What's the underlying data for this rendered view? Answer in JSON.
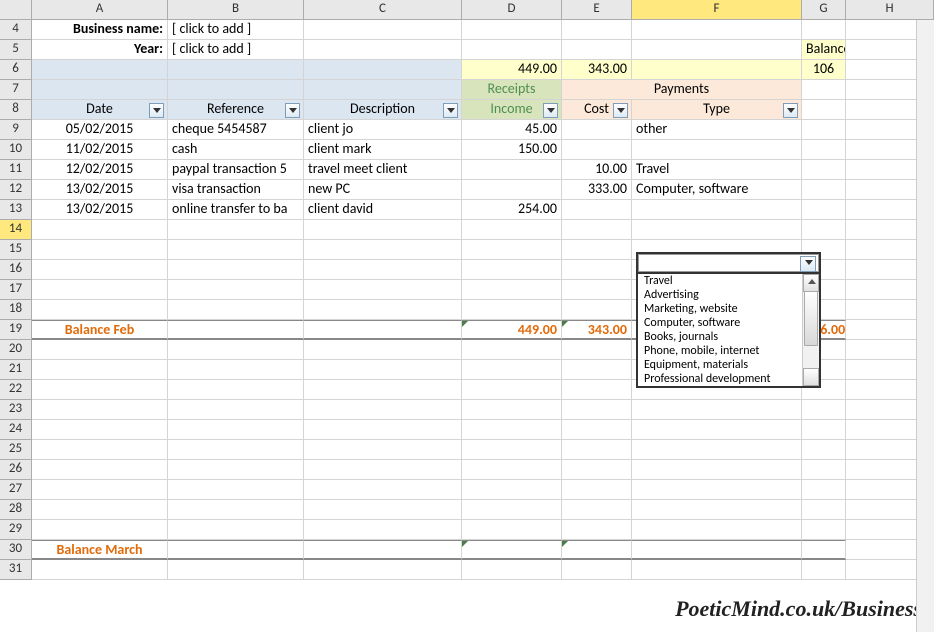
{
  "columns": [
    "A",
    "B",
    "C",
    "D",
    "E",
    "F",
    "G",
    "H"
  ],
  "rowNums": [
    4,
    5,
    6,
    7,
    8,
    9,
    10,
    11,
    12,
    13,
    14,
    15,
    16,
    17,
    18,
    19,
    20,
    21,
    22,
    23,
    24,
    25,
    26,
    27,
    28,
    29,
    30,
    31
  ],
  "labels": {
    "business": "Business name:",
    "year": "Year:",
    "placeholder": "[ click to add ]",
    "receipts": "Receipts",
    "payments": "Payments",
    "balance": "Balance"
  },
  "headers": {
    "date": "Date",
    "reference": "Reference",
    "description": "Description",
    "income": "Income",
    "cost": "Cost",
    "type": "Type"
  },
  "sums": {
    "receipts": "449.00",
    "payments": "343.00",
    "balance": "106"
  },
  "rows": [
    {
      "date": "05/02/2015",
      "reference": "cheque 5454587",
      "description": "client jo",
      "income": "45.00",
      "cost": "",
      "type": "other"
    },
    {
      "date": "11/02/2015",
      "reference": "cash",
      "description": "client mark",
      "income": "150.00",
      "cost": "",
      "type": ""
    },
    {
      "date": "12/02/2015",
      "reference": "paypal transaction 5",
      "description": "travel meet client",
      "income": "",
      "cost": "10.00",
      "type": "Travel"
    },
    {
      "date": "13/02/2015",
      "reference": "visa transaction",
      "description": "new PC",
      "income": "",
      "cost": "333.00",
      "type": "Computer, software"
    },
    {
      "date": "13/02/2015",
      "reference": "online transfer to ba",
      "description": "client david",
      "income": "254.00",
      "cost": "",
      "type": ""
    }
  ],
  "balanceRows": {
    "feb": {
      "label": "Balance Feb",
      "income": "449.00",
      "cost": "343.00",
      "bal": "106.00"
    },
    "march": {
      "label": "Balance March"
    }
  },
  "dropdown": [
    "Travel",
    "Advertising",
    "Marketing, website",
    "Computer, software",
    "Books, journals",
    "Phone, mobile, internet",
    "Equipment, materials",
    "Professional development"
  ],
  "watermark": "PoeticMind.co.uk/Business",
  "selectedCol": 5,
  "selectedRow": 14
}
